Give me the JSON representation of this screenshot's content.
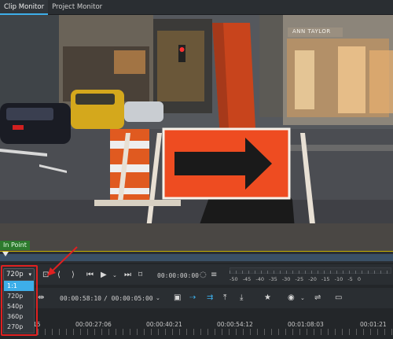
{
  "tabs": [
    {
      "label": "Clip Monitor",
      "active": true
    },
    {
      "label": "Project Monitor",
      "active": false
    }
  ],
  "video": {
    "in_point_label": "In Point",
    "store_sign": "ANN TAYLOR"
  },
  "monitor_toolbar": {
    "zoom_selected": "720p",
    "zoom_options": [
      "1:1",
      "720p",
      "540p",
      "360p",
      "270p"
    ],
    "timecode": "00:00:00:00",
    "audio_meter_scale": [
      "-50",
      "-45",
      "-40",
      "-35",
      "-30",
      "-25",
      "-20",
      "-15",
      "-10",
      "-5",
      "0"
    ]
  },
  "timeline_toolbar": {
    "position_timecode": "00:00:58:10",
    "duration_timecode": "/ 00:00:05:00"
  },
  "timeline_ruler": {
    "labels": [
      "15",
      "00:00:27:06",
      "00:00:40:21",
      "00:00:54:12",
      "00:01:08:03",
      "00:01:21"
    ]
  },
  "colors": {
    "accent": "#3daee9",
    "highlight": "#e02020",
    "in_point": "#2d7a2d",
    "arrow_sign": "#ee4c21"
  }
}
